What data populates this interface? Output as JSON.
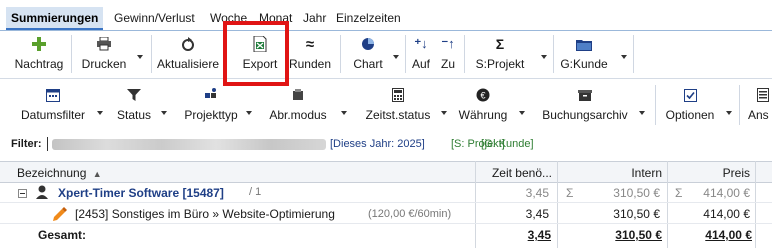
{
  "tabs": [
    {
      "label": "Summierungen",
      "active": true
    },
    {
      "label": "Gewinn/Verlust"
    },
    {
      "label": "Woche"
    },
    {
      "label": "Monat"
    },
    {
      "label": "Jahr"
    },
    {
      "label": "Einzelzeiten"
    }
  ],
  "toolbar1": {
    "nachtrag": "Nachtrag",
    "drucken": "Drucken",
    "aktualisieren": "Aktualisiere",
    "export": "Export",
    "runden": "Runden",
    "chart": "Chart",
    "auf": "Auf",
    "zu": "Zu",
    "sprojekt": "S:Projekt",
    "gkunde": "G:Kunde"
  },
  "toolbar2": {
    "datumsfilter": "Datumsfilter",
    "status": "Status",
    "projekttyp": "Projekttyp",
    "abrmodus": "Abr.modus",
    "zeitststatus": "Zeitst.status",
    "waehrung": "Währung",
    "buchungsarchiv": "Buchungsarchiv",
    "optionen": "Optionen",
    "ansicht": "Ans"
  },
  "filter": {
    "label": "Filter:",
    "dieses_jahr": "[Dieses Jahr: 2025]",
    "s_projekt": "[S: Projekt]",
    "g_kunde": "[G: Kunde]"
  },
  "grid": {
    "headers": {
      "bezeichnung": "Bezeichnung",
      "zeit": "Zeit benö...",
      "intern": "Intern",
      "preis": "Preis"
    },
    "rows": [
      {
        "name": "Xpert-Timer Software [15487]",
        "suffix": "/ 1",
        "zeit": "3,45",
        "sigma1": "Σ",
        "intern": "310,50 €",
        "sigma2": "Σ",
        "preis": "414,00 €"
      },
      {
        "name": "[2453] Sonstiges im Büro » Website-Optimierung",
        "rate": "(120,00 €/60min)",
        "zeit": "3,45",
        "intern": "310,50 €",
        "preis": "414,00 €"
      },
      {
        "name": "Gesamt:",
        "zeit": "3,45",
        "intern": "310,50 €",
        "preis": "414,00 €"
      }
    ]
  },
  "colors": {
    "accent": "#3a74c4",
    "highlight": "#e01414",
    "project_blue": "#1f3f86",
    "filter_green": "#2e7d32"
  }
}
